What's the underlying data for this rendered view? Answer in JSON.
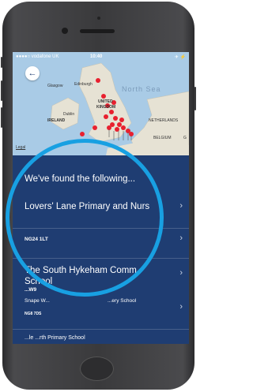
{
  "statusbar": {
    "carrier": "●●●●○ vodafone UK",
    "time": "10:40",
    "right": "✈ ⚡"
  },
  "map": {
    "labels": {
      "glasgow": "Glasgow",
      "edinburgh": "Edinburgh",
      "north_sea": "North Sea",
      "united": "UNITED",
      "kingdom": "KINGDOM",
      "dublin": "Dublin",
      "ireland": "IRELAND",
      "netherlands": "NETHERLANDS",
      "belgium": "BELGIUM",
      "g": "G"
    },
    "legal": "Legal"
  },
  "back_icon": "arrow-left-icon",
  "results": {
    "heading": "We've found the following...",
    "items": [
      {
        "name": "Lovers' Lane Primary and Nurs",
        "postcode": "NG24 1LT"
      },
      {
        "name": "The South Hykeham Comm",
        "name2": "School",
        "postcode": "...W9"
      },
      {
        "name": "Snape W...",
        "subname": "...ery School",
        "postcode": "NG8 7DS"
      },
      {
        "name": "...le ...rth Primary School",
        "postcode": ""
      }
    ]
  },
  "colors": {
    "panel": "#1f3d72",
    "highlight_ring": "#18a0e2",
    "pin": "#e8202f"
  }
}
